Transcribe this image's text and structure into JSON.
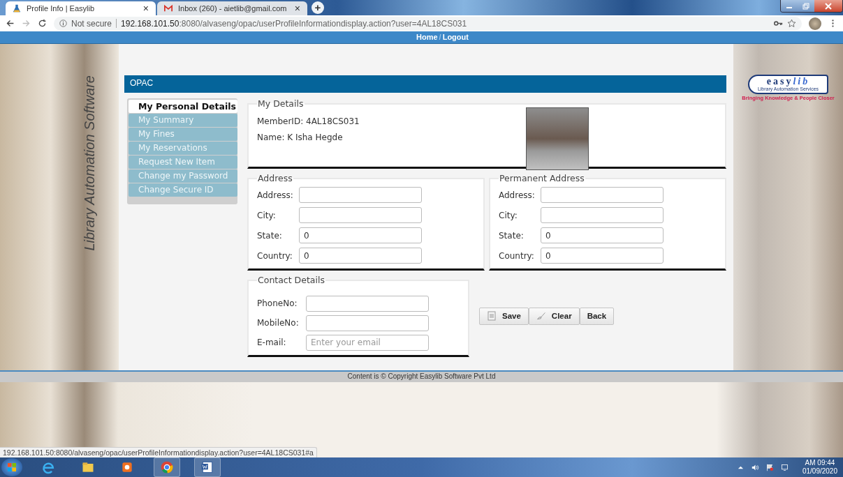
{
  "browser": {
    "tabs": [
      {
        "title": "Profile Info | Easylib",
        "selected": true,
        "close": "×"
      },
      {
        "title": "Inbox (260) - aietlib@gmail.com",
        "selected": false,
        "close": "×"
      }
    ],
    "new_tab": "+",
    "security": "Not secure",
    "url_host": "192.168.101.50",
    "url_rest": ":8080/alvaseng/opac/userProfileInformationdisplay.action?user=4AL18CS031"
  },
  "nav": {
    "links": [
      "Home",
      "Logout"
    ],
    "separator": "/"
  },
  "side_title": "Library Automation Software",
  "header": "OPAC",
  "menu": [
    {
      "label": "My Personal Details",
      "selected": true
    },
    {
      "label": "My Summary",
      "selected": false
    },
    {
      "label": "My Fines",
      "selected": false
    },
    {
      "label": "My Reservations",
      "selected": false
    },
    {
      "label": "Request New Item",
      "selected": false
    },
    {
      "label": "Change my Password",
      "selected": false
    },
    {
      "label": "Change Secure ID",
      "selected": false
    }
  ],
  "my_details": {
    "legend": "My Details",
    "member_id": "MemberID: 4AL18CS031",
    "name": "Name: K Isha Hegde"
  },
  "address": {
    "legend": "Address",
    "fields": [
      {
        "label": "Address:"
      },
      {
        "label": "City:"
      },
      {
        "label": "State:",
        "value": "0"
      },
      {
        "label": "Country:",
        "value": "0"
      }
    ]
  },
  "permanent_address": {
    "legend": "Permanent Address",
    "fields": [
      {
        "label": "Address:"
      },
      {
        "label": "City:"
      },
      {
        "label": "State:",
        "value": "0"
      },
      {
        "label": "Country:",
        "value": "0"
      }
    ]
  },
  "contact": {
    "legend": "Contact Details",
    "fields": [
      {
        "label": "PhoneNo:"
      },
      {
        "label": "MobileNo:"
      },
      {
        "label": "E-mail:",
        "placeholder": "Enter your email"
      }
    ]
  },
  "buttons": [
    {
      "label": "Save",
      "kind": "save"
    },
    {
      "label": "Clear",
      "kind": "clear"
    },
    {
      "label": "Back",
      "kind": "back"
    }
  ],
  "logo": {
    "word_a": "easy",
    "word_b": "lib",
    "subtitle": "Library Automation Services",
    "tagline": "Bringing Knowledge & People Closer"
  },
  "footer": "Content is © Copyright Easylib Software Pvt Ltd",
  "status_url": "192.168.101.50:8080/alvaseng/opac/userProfileInformationdisplay.action?user=4AL18CS031#a",
  "clock": {
    "time": "AM 09:44",
    "date": "01/09/2020"
  }
}
